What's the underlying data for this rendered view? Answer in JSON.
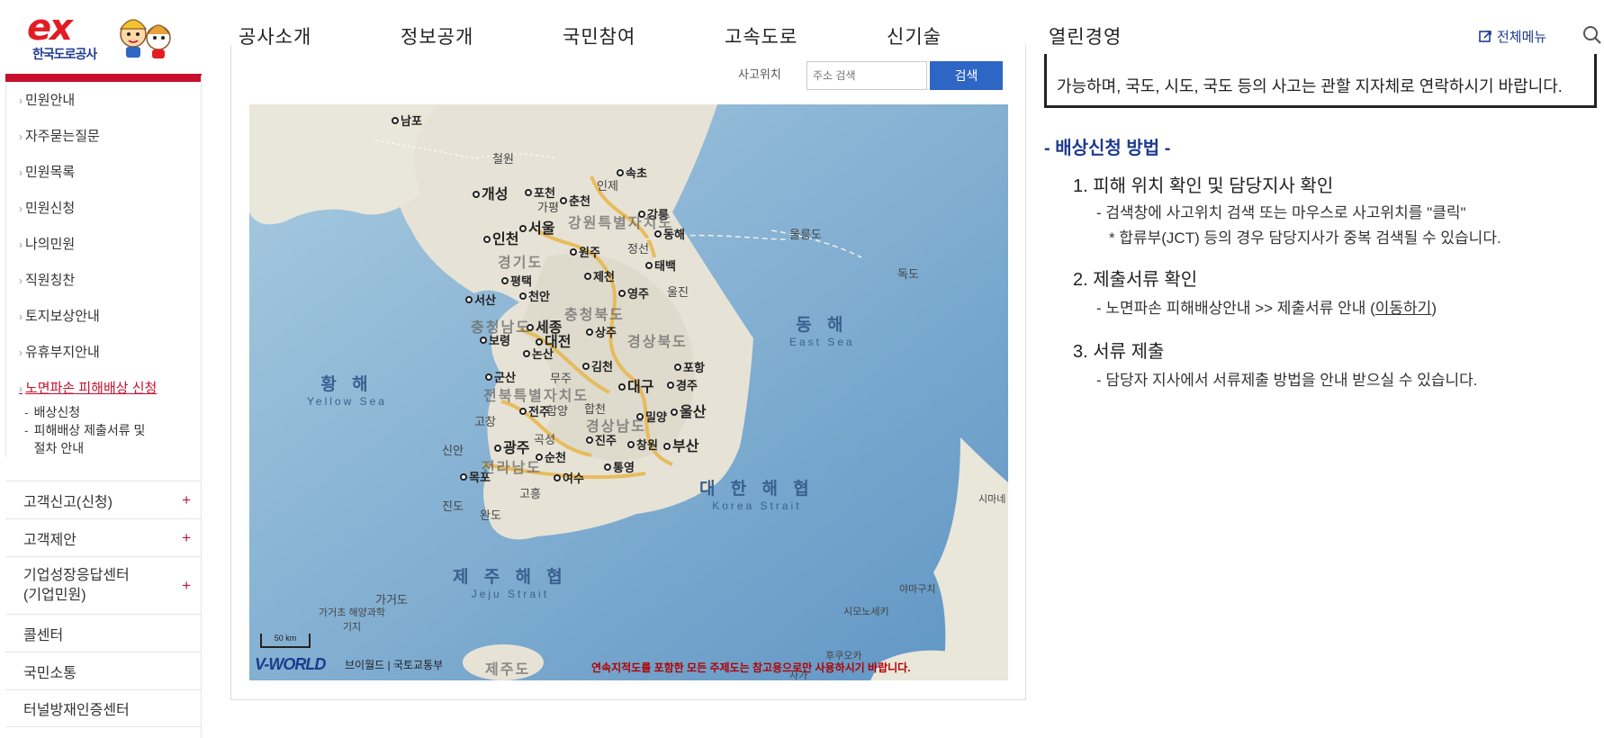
{
  "header": {
    "logo_text": "ex",
    "logo_name": "한국도로공사",
    "nav": [
      "공사소개",
      "정보공개",
      "국민참여",
      "고속도로",
      "신기술",
      "열린경영"
    ],
    "all_menu_label": "전체메뉴"
  },
  "sidebar": {
    "sub_items": [
      "민원안내",
      "자주묻는질문",
      "민원목록",
      "민원신청",
      "나의민원",
      "직원칭찬",
      "토지보상안내",
      "유휴부지안내",
      "노면파손 피해배상 신청"
    ],
    "third_items": [
      "배상신청",
      "피해배상 제출서류 및 절차 안내"
    ],
    "main_items": [
      "고객신고(신청)",
      "고객제안",
      "기업성장응답센터(기업민원)",
      "콜센터",
      "국민소통",
      "터널방재인증센터"
    ],
    "plus_symbol": "+"
  },
  "map": {
    "search_label": "사고위치",
    "search_placeholder": "주소 검색",
    "search_button": "검색",
    "cities": [
      "남포",
      "개성",
      "포천",
      "춘천",
      "속초",
      "강릉",
      "동해",
      "인천",
      "서울",
      "원주",
      "태백",
      "평택",
      "제천",
      "영주",
      "서산",
      "천안",
      "세종",
      "대전",
      "상주",
      "보령",
      "논산",
      "포항",
      "군산",
      "김천",
      "대구",
      "경주",
      "전주",
      "밀양",
      "울산",
      "광주",
      "진주",
      "창원",
      "부산",
      "순천",
      "통영",
      "목포",
      "여수"
    ],
    "light_places": [
      "철원",
      "인제",
      "가평",
      "정선",
      "울진",
      "무주",
      "합천",
      "함양",
      "고창",
      "곡성",
      "신안",
      "고흥",
      "진도",
      "완도",
      "가거도",
      "가거초 해양과학기지",
      "울릉도",
      "독도",
      "시마네",
      "야마구치",
      "시모노세키",
      "후쿠오카",
      "사가"
    ],
    "regions": [
      "강원특별자치도",
      "경기도",
      "충청북도",
      "충청남도",
      "경상북도",
      "전북특별자치도",
      "경상남도",
      "전라남도",
      "제주도"
    ],
    "seas": [
      {
        "ko": "동 해",
        "en": "East Sea"
      },
      {
        "ko": "황 해",
        "en": "Yellow Sea"
      },
      {
        "ko": "대 한 해 협",
        "en": "Korea Strait"
      },
      {
        "ko": "제 주 해 협",
        "en": "Jeju Strait"
      }
    ],
    "scale_label": "50 km",
    "brand": "V-WORLD",
    "brand_links": "브이월드 | 국토교통부",
    "warning": "연속지적도를 포함한 모든 주제도는 참고용으로만 사용하시기 바랍니다."
  },
  "content": {
    "notice": "가능하며, 국도, 시도, 국도 등의 사고는 관할 지자체로 연락하시기 바랍니다.",
    "section_title": "- 배상신청 방법 -",
    "steps": [
      {
        "title": "1. 피해 위치 확인 및 담당지사 확인",
        "desc": "- 검색창에 사고위치 검색 또는 마우스로 사고위치를 \"클릭\"",
        "note": "* 합류부(JCT) 등의 경우 담당지사가 중복 검색될 수 있습니다."
      },
      {
        "title": "2. 제출서류 확인",
        "desc": "- 노면파손 피해배상안내 >> 제출서류 안내 (",
        "link": "이동하기",
        "desc_end": ")"
      },
      {
        "title": "3. 서류 제출",
        "desc": "- 담당자 지사에서 서류제출 방법을 안내 받으실 수 있습니다."
      }
    ]
  },
  "colors": {
    "brand_red": "#c8102e",
    "brand_blue": "#1f3b8f",
    "button_blue": "#2e66c5"
  }
}
